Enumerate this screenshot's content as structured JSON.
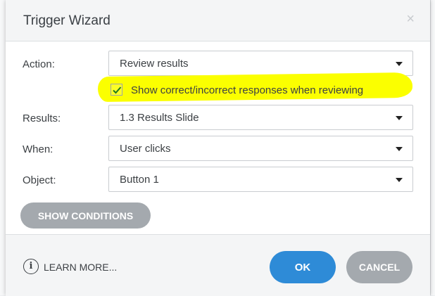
{
  "dialog": {
    "title": "Trigger Wizard",
    "close_symbol": "×"
  },
  "form": {
    "action": {
      "label": "Action:",
      "value": "Review results"
    },
    "review_checkbox": {
      "label": "Show correct/incorrect responses when reviewing",
      "checked": true
    },
    "results": {
      "label": "Results:",
      "value": "1.3 Results Slide"
    },
    "when": {
      "label": "When:",
      "value": "User clicks"
    },
    "object": {
      "label": "Object:",
      "value": "Button 1"
    }
  },
  "buttons": {
    "show_conditions": "SHOW CONDITIONS",
    "learn_more": "LEARN MORE...",
    "ok": "OK",
    "cancel": "CANCEL"
  },
  "colors": {
    "primary": "#2e8bd7",
    "secondary_button": "#a4a9ae",
    "annotation_highlight": "#fbff00",
    "checkmark": "#1f7a1f"
  },
  "icons": [
    "close-icon",
    "chevron-down-icon",
    "checkmark-icon",
    "info-icon"
  ]
}
